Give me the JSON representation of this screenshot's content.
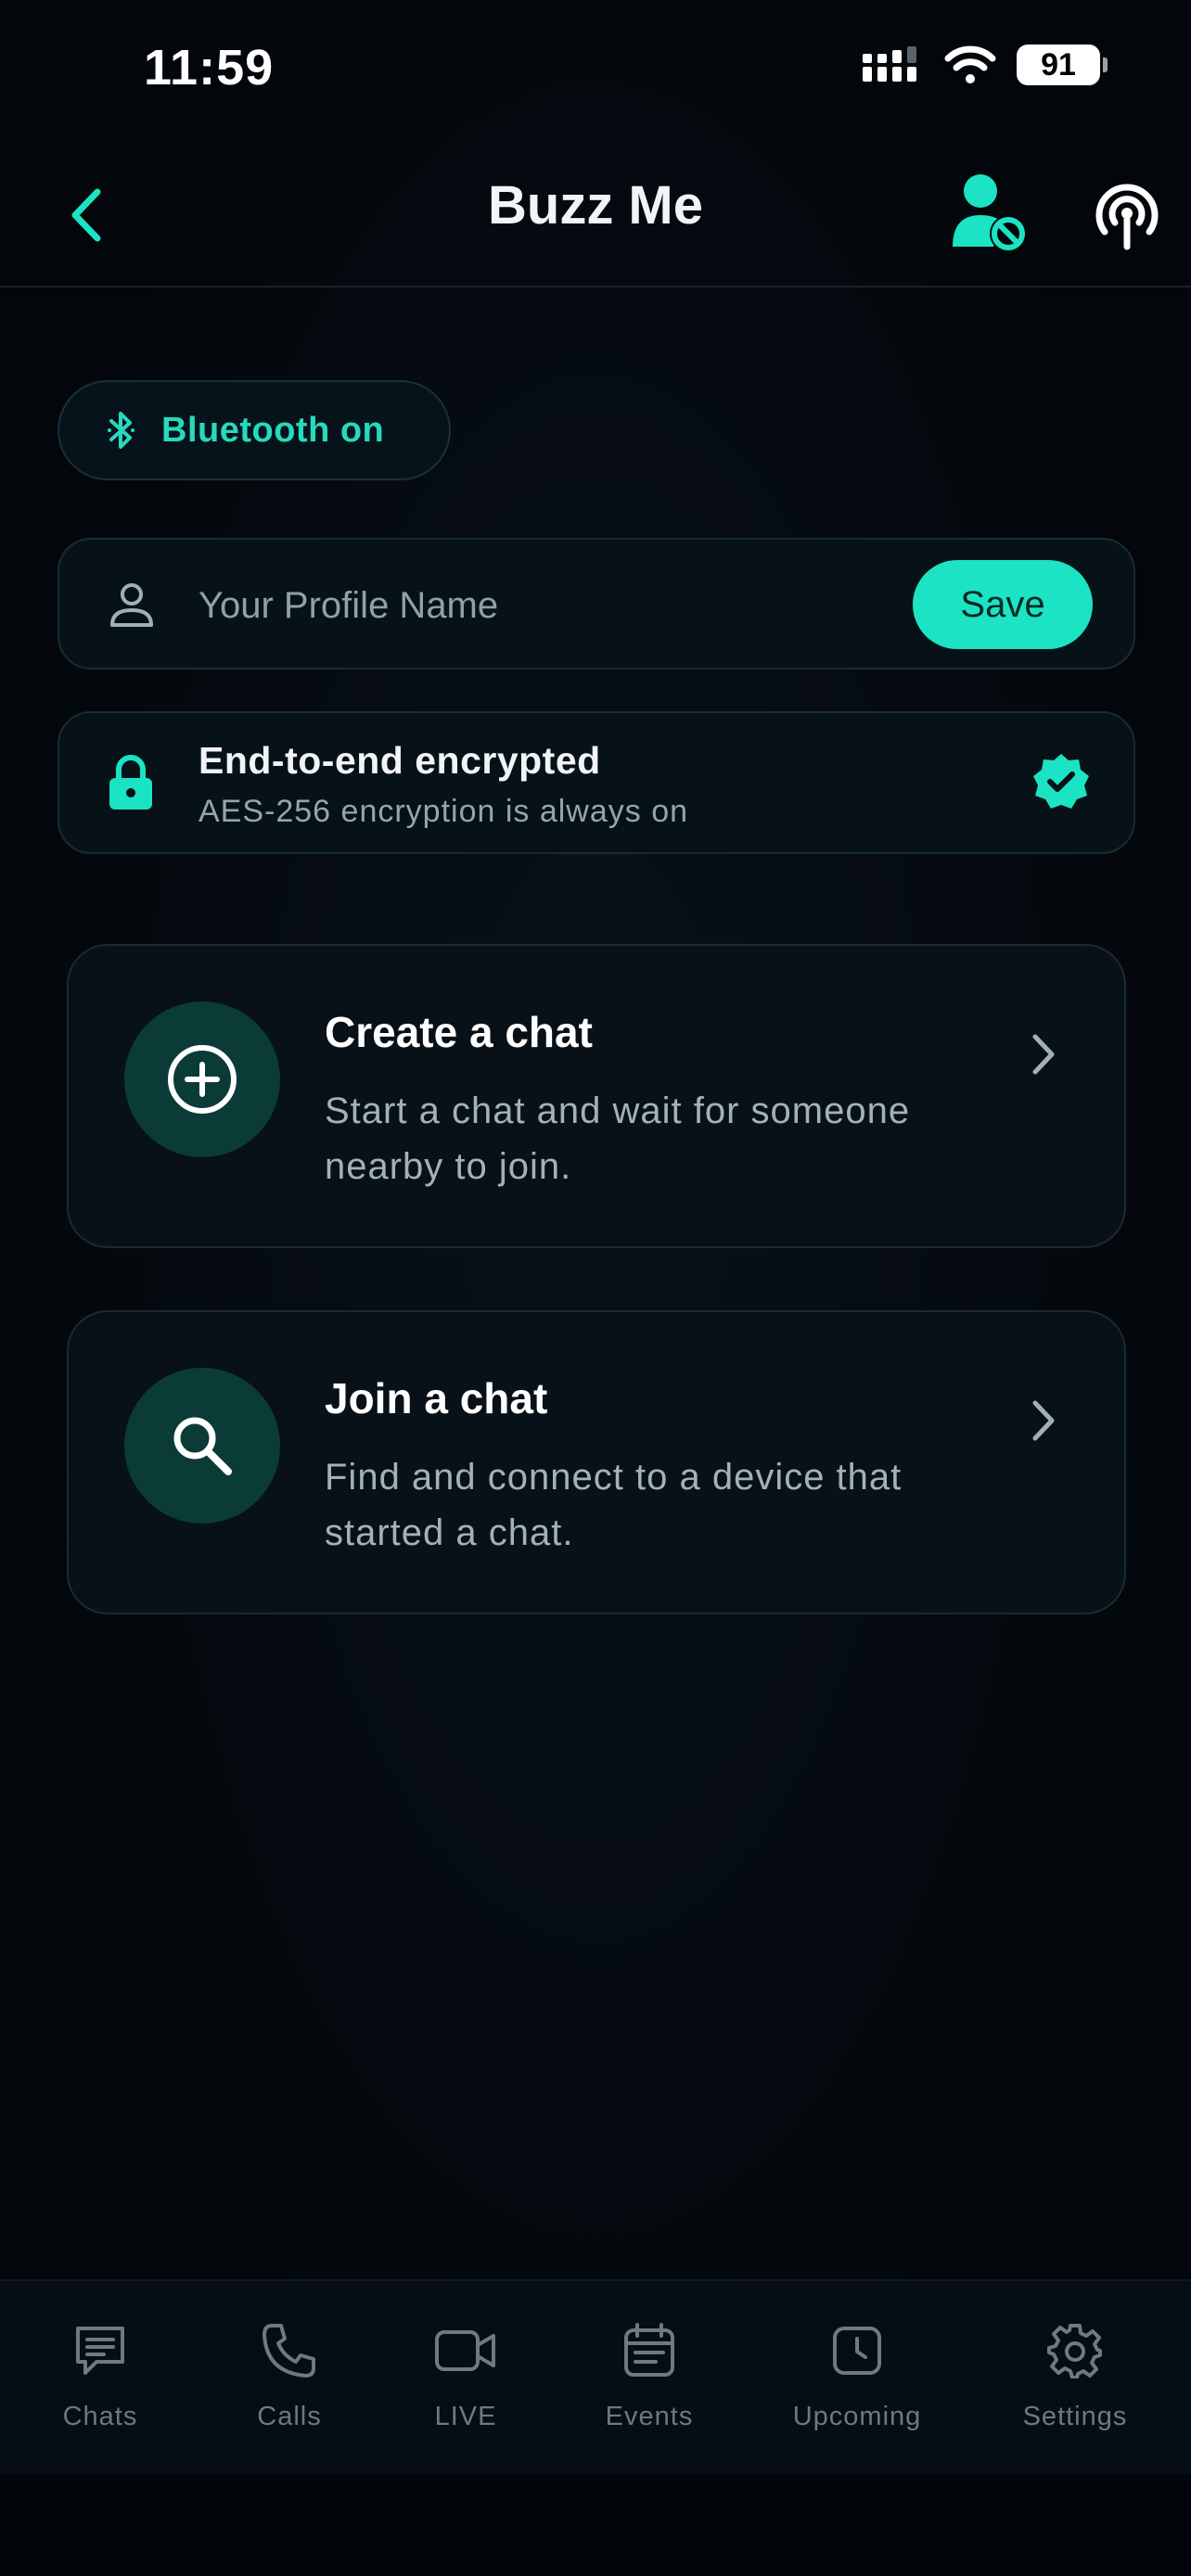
{
  "status_bar": {
    "time": "11:59",
    "battery": "91",
    "icons": [
      "cellular-signal-icon",
      "wifi-icon",
      "battery-icon"
    ]
  },
  "header": {
    "title": "Buzz Me",
    "icons": [
      "back-chevron-icon",
      "user-block-icon",
      "broadcast-icon"
    ]
  },
  "bluetooth": {
    "label": "Bluetooth on",
    "icon": "bluetooth-icon"
  },
  "profile": {
    "placeholder": "Your Profile Name",
    "value": "",
    "save_label": "Save",
    "icon": "person-icon"
  },
  "encryption": {
    "title": "End-to-end encrypted",
    "subtitle": "AES-256 encryption is always on",
    "icons": [
      "lock-icon",
      "verified-badge-icon"
    ]
  },
  "cards": [
    {
      "title": "Create a chat",
      "description": "Start a chat and wait for someone nearby to join.",
      "icon": "plus-circle-icon"
    },
    {
      "title": "Join a chat",
      "description": "Find and connect to a device that started a chat.",
      "icon": "search-icon"
    }
  ],
  "tabs": [
    {
      "label": "Chats",
      "icon": "chat-bubble-icon"
    },
    {
      "label": "Calls",
      "icon": "phone-icon"
    },
    {
      "label": "LIVE",
      "icon": "video-camera-icon"
    },
    {
      "label": "Events",
      "icon": "calendar-icon"
    },
    {
      "label": "Upcoming",
      "icon": "clock-icon"
    },
    {
      "label": "Settings",
      "icon": "gear-icon"
    }
  ],
  "colors": {
    "accent": "#1be3c3",
    "background": "#03070b",
    "card_circle": "#0b3b36",
    "tab_inactive": "#6c7a82"
  }
}
